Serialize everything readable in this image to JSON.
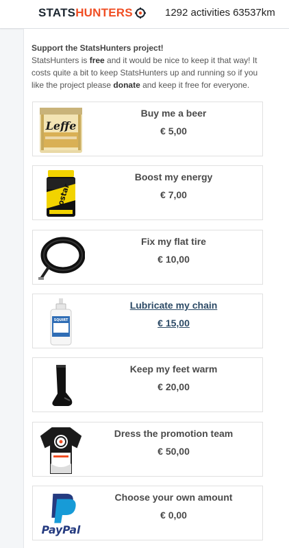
{
  "header": {
    "logo_part1": "STATS",
    "logo_part2": "HUNTERS",
    "activities": "1292 activities",
    "distance": "63537km"
  },
  "intro": {
    "title": "Support the StatsHunters project!",
    "p1": "StatsHunters is ",
    "free": "free",
    "p2": " and it would be nice to keep it that way! It costs quite a bit to keep StatsHunters up and running so if you like the project please ",
    "donate": "donate",
    "p3": " and keep it free for everyone."
  },
  "donations": [
    {
      "name": "Buy me a beer",
      "price": "€ 5,00",
      "icon": "beer-pack-icon"
    },
    {
      "name": "Boost my energy",
      "price": "€ 7,00",
      "icon": "energy-drink-icon"
    },
    {
      "name": "Fix my flat tire",
      "price": "€ 10,00",
      "icon": "inner-tube-icon"
    },
    {
      "name": "Lubricate my chain",
      "price": "€ 15,00",
      "icon": "chain-lube-icon"
    },
    {
      "name": "Keep my feet warm",
      "price": "€ 20,00",
      "icon": "sock-icon"
    },
    {
      "name": "Dress the promotion team",
      "price": "€ 50,00",
      "icon": "jersey-icon"
    },
    {
      "name": "Choose your own amount",
      "price": "€ 0,00",
      "icon": "paypal-icon"
    }
  ],
  "paypal_logo_text": "PayPal",
  "beer_brand_text": "Leffe",
  "colors": {
    "brand_orange": "#f04e23",
    "brand_dark": "#1c2630",
    "link_blue": "#2c4a66"
  }
}
